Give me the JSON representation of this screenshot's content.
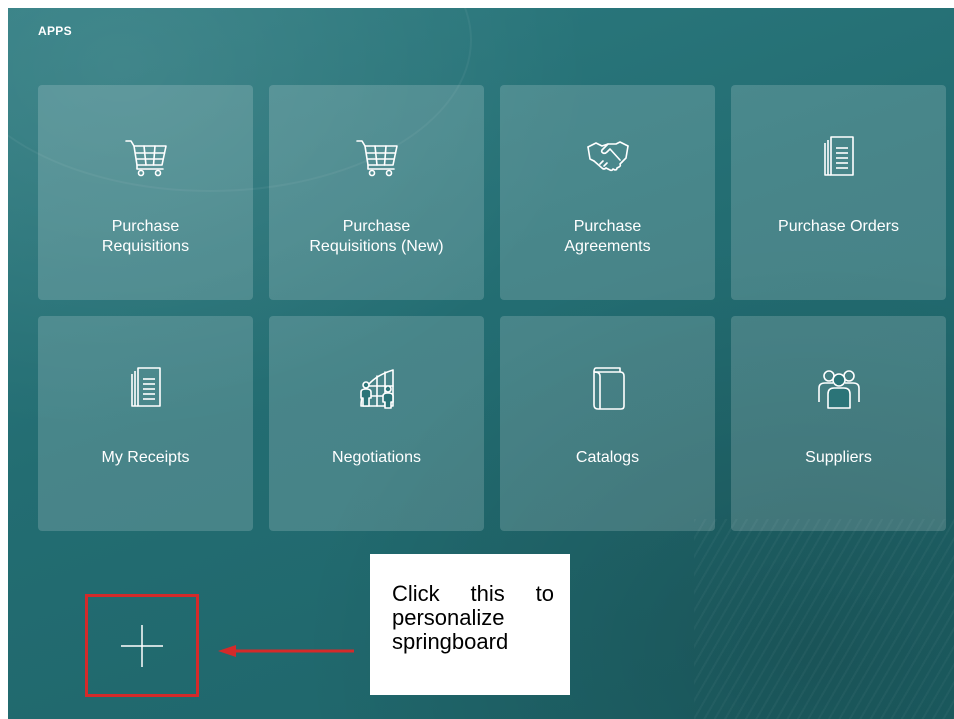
{
  "header": {
    "title": "APPS"
  },
  "tiles": [
    {
      "label": "Purchase\nRequisitions",
      "icon": "shopping-cart-icon"
    },
    {
      "label": "Purchase\nRequisitions (New)",
      "icon": "shopping-cart-icon"
    },
    {
      "label": "Purchase\nAgreements",
      "icon": "handshake-icon"
    },
    {
      "label": "Purchase Orders",
      "icon": "document-stack-icon"
    },
    {
      "label": "My Receipts",
      "icon": "document-stack-icon"
    },
    {
      "label": "Negotiations",
      "icon": "negotiation-people-icon"
    },
    {
      "label": "Catalogs",
      "icon": "catalog-book-icon"
    },
    {
      "label": "Suppliers",
      "icon": "people-group-icon"
    }
  ],
  "add_button": {
    "icon": "plus-icon"
  },
  "callout": {
    "line1": "Click this to",
    "line2": "personalize",
    "line3": "springboard",
    "highlight_color": "#d42a2a"
  },
  "colors": {
    "background": "#236d72",
    "tile": "rgba(255,255,255,0.17)",
    "text": "#ffffff"
  }
}
